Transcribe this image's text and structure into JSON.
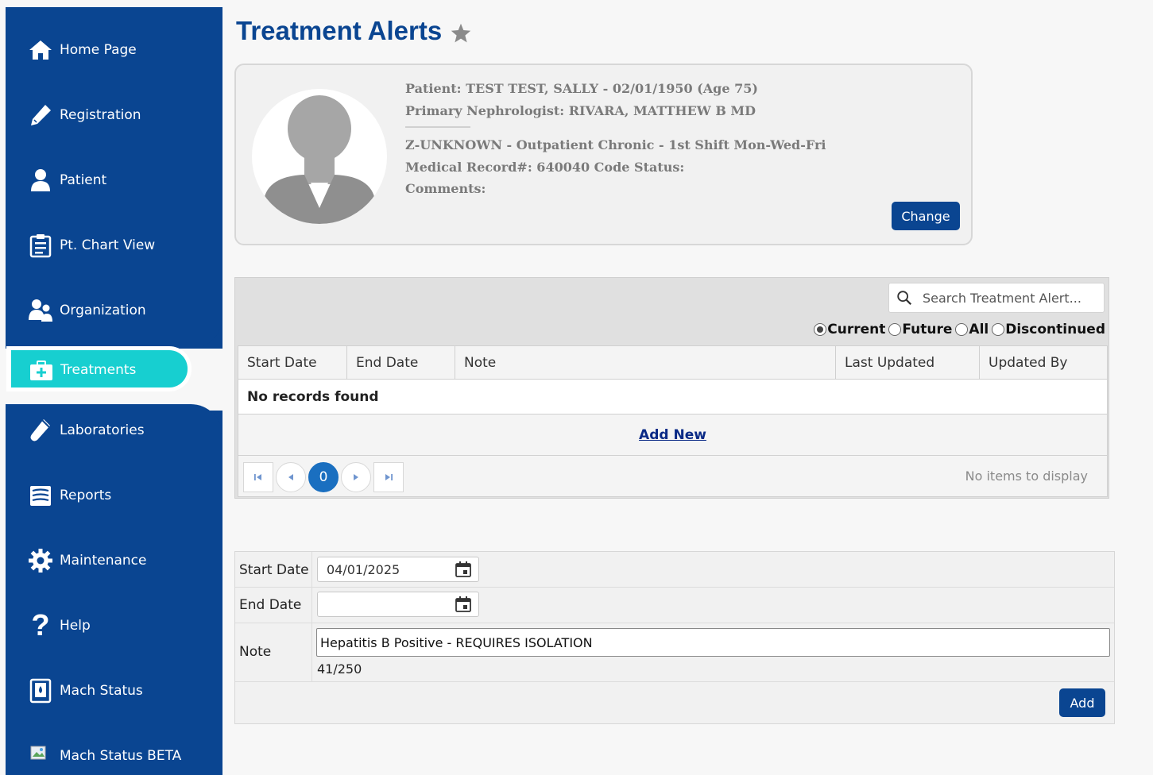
{
  "sidebar": {
    "items": [
      {
        "label": "Home Page",
        "icon": "home-icon"
      },
      {
        "label": "Registration",
        "icon": "pencil-icon"
      },
      {
        "label": "Patient",
        "icon": "person-icon"
      },
      {
        "label": "Pt. Chart View",
        "icon": "clipboard-icon"
      },
      {
        "label": "Organization",
        "icon": "people-icon"
      },
      {
        "label": "Treatments",
        "icon": "medical-kit-icon",
        "active": true
      },
      {
        "label": "Laboratories",
        "icon": "test-tube-icon"
      },
      {
        "label": "Reports",
        "icon": "report-icon"
      },
      {
        "label": "Maintenance",
        "icon": "gear-icon"
      },
      {
        "label": "Help",
        "icon": "question-icon"
      },
      {
        "label": "Mach Status",
        "icon": "machine-icon"
      },
      {
        "label": "Mach Status BETA",
        "icon": "broken-image-icon"
      }
    ],
    "color": "#0a4591",
    "active_color": "#17cfd0"
  },
  "header": {
    "title": "Treatment Alerts"
  },
  "patient": {
    "line1": "Patient: TEST TEST, SALLY - 02/01/1950 (Age 75)",
    "line2": "Primary Nephrologist: RIVARA, MATTHEW B MD",
    "line3": "Z-UNKNOWN - Outpatient Chronic - 1st Shift Mon-Wed-Fri",
    "line4": "Medical Record#: 640040 Code Status:",
    "line5": "Comments:",
    "change_label": "Change"
  },
  "grid": {
    "search_placeholder": "Search Treatment Alert...",
    "filters": [
      {
        "label": "Current",
        "selected": true
      },
      {
        "label": "Future",
        "selected": false
      },
      {
        "label": "All",
        "selected": false
      },
      {
        "label": "Discontinued",
        "selected": false
      }
    ],
    "columns": [
      "Start Date",
      "End Date",
      "Note",
      "Last Updated",
      "Updated By"
    ],
    "empty_text": "No records found",
    "add_new_label": "Add New",
    "pager": {
      "page": "0",
      "status": "No items to display"
    }
  },
  "form": {
    "start_date_label": "Start Date",
    "start_date_value": "04/01/2025",
    "end_date_label": "End Date",
    "end_date_value": "",
    "note_label": "Note",
    "note_value": "Hepatitis B Positive - REQUIRES ISOLATION",
    "char_count": "41/250",
    "add_label": "Add"
  }
}
